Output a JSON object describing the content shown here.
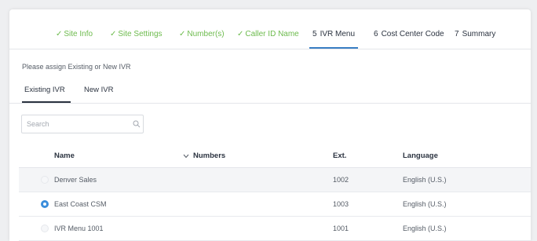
{
  "stepper": {
    "steps": [
      {
        "marker": "✓",
        "label": "Site Info",
        "state": "done"
      },
      {
        "marker": "✓",
        "label": "Site Settings",
        "state": "done"
      },
      {
        "marker": "✓",
        "label": "Number(s)",
        "state": "done"
      },
      {
        "marker": "✓",
        "label": "Caller ID Name",
        "state": "done"
      },
      {
        "marker": "5",
        "label": "IVR Menu",
        "state": "active"
      },
      {
        "marker": "6",
        "label": "Cost Center Code",
        "state": "todo"
      },
      {
        "marker": "7",
        "label": "Summary",
        "state": "todo"
      }
    ]
  },
  "prompt": "Please assign Existing or New IVR",
  "tabs": {
    "existing": "Existing IVR",
    "new": "New IVR",
    "selected": "existing"
  },
  "search": {
    "placeholder": "Search",
    "value": ""
  },
  "table": {
    "columns": [
      "Name",
      "Numbers",
      "Ext.",
      "Language"
    ],
    "rows": [
      {
        "name": "Denver Sales",
        "numbers": "",
        "ext": "1002",
        "language": "English (U.S.)",
        "selected": false
      },
      {
        "name": "East Coast CSM",
        "numbers": "",
        "ext": "1003",
        "language": "English (U.S.)",
        "selected": true
      },
      {
        "name": "IVR Menu 1001",
        "numbers": "",
        "ext": "1001",
        "language": "English (U.S.)",
        "selected": false
      }
    ]
  },
  "colors": {
    "done": "#6dbb4d",
    "accent": "#3a7fc4",
    "radio_on": "#3a8ddb"
  }
}
